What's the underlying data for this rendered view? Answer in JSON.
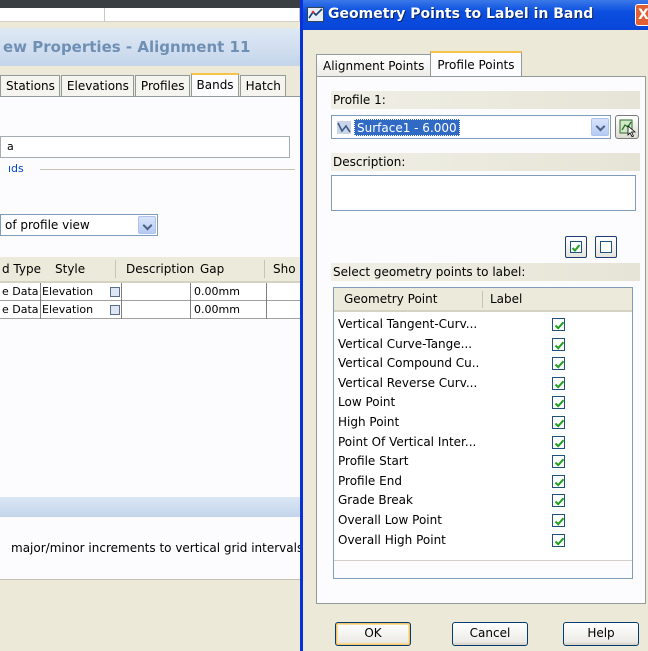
{
  "background_window": {
    "title": "ew Properties - Alignment 11",
    "tabs": [
      {
        "label": "Stations",
        "active": false
      },
      {
        "label": "Elevations",
        "active": false
      },
      {
        "label": "Profiles",
        "active": false
      },
      {
        "label": "Bands",
        "active": true
      },
      {
        "label": "Hatch",
        "active": false
      }
    ],
    "field_fragment": "a",
    "group_label": "ıds",
    "location_select": "of profile view",
    "table": {
      "headers": [
        "d Type",
        "Style",
        "Description",
        "Gap",
        "Sho"
      ],
      "rows": [
        {
          "type": "e Data",
          "style": "Elevation",
          "gap": "0.00mm"
        },
        {
          "type": "e Data",
          "style": "Elevation",
          "gap": "0.00mm"
        }
      ]
    },
    "description_text": "major/minor increments to vertical grid intervals"
  },
  "dialog": {
    "title": "Geometry Points to Label in Band",
    "close_glyph": "X",
    "tabs": [
      {
        "label": "Alignment Points",
        "active": false
      },
      {
        "label": "Profile Points",
        "active": true
      }
    ],
    "profile_label": "Profile 1:",
    "profile_value": "Surface1 - 6.000",
    "description_label": "Description:",
    "description_value": "",
    "select_label": "Select geometry points to label:",
    "grid": {
      "col_point": "Geometry Point",
      "col_label": "Label",
      "rows": [
        {
          "name": "Vertical Tangent-Curv...",
          "checked": true
        },
        {
          "name": "Vertical Curve-Tange...",
          "checked": true
        },
        {
          "name": "Vertical Compound Cu...",
          "checked": true
        },
        {
          "name": "Vertical Reverse Curv...",
          "checked": true
        },
        {
          "name": "Low Point",
          "checked": true
        },
        {
          "name": "High Point",
          "checked": true
        },
        {
          "name": "Point Of Vertical Inter...",
          "checked": true
        },
        {
          "name": "Profile Start",
          "checked": true
        },
        {
          "name": "Profile End",
          "checked": true
        },
        {
          "name": "Grade Break",
          "checked": true
        },
        {
          "name": "Overall Low Point",
          "checked": true
        },
        {
          "name": "Overall High Point",
          "checked": true
        }
      ]
    },
    "buttons": {
      "ok": "OK",
      "cancel": "Cancel",
      "help": "Help"
    },
    "colors": {
      "title_bar": "#0a4ee0",
      "selection": "#316ac5",
      "tab_highlight": "#f7c44a",
      "check_green": "#21a121"
    }
  }
}
